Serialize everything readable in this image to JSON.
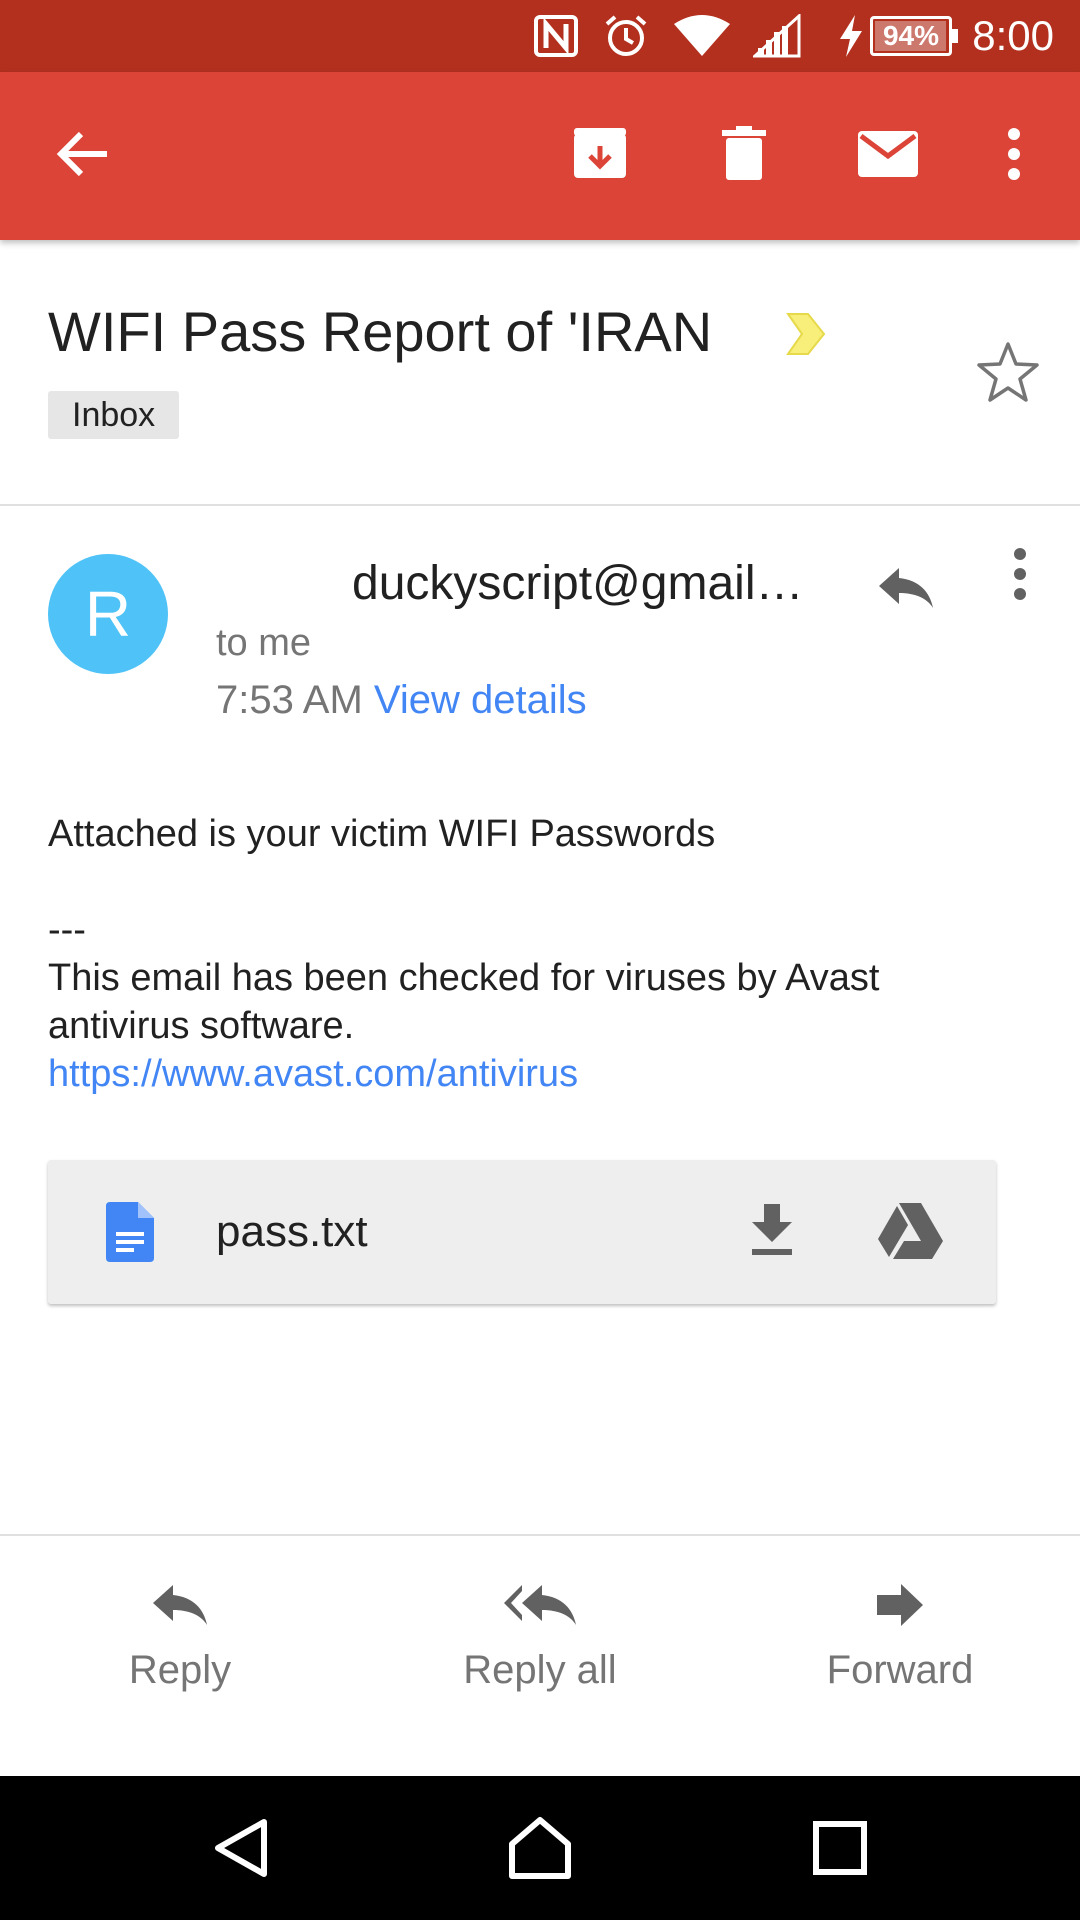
{
  "status_bar": {
    "time": "8:00",
    "battery_percent_label": "94%",
    "battery_level": 0.94,
    "icons": [
      "nfc-icon",
      "alarm-icon",
      "wifi-icon",
      "cell-signal-icon",
      "charging-bolt-icon",
      "battery-icon"
    ]
  },
  "app_bar": {
    "actions": [
      "back-arrow-icon",
      "archive-icon",
      "delete-icon",
      "mark-unread-icon",
      "overflow-menu-icon"
    ],
    "color": "#db4437",
    "status_color": "#b3301f"
  },
  "thread": {
    "subject": "WIFI Pass Report of  ʹIRAN",
    "label": "Inbox",
    "starred": false,
    "importance_marker_color": "#f7ef7a"
  },
  "message": {
    "avatar_letter": "R",
    "avatar_color": "#4fc3f7",
    "sender": "duckyscript@gmail.com",
    "recipient": "to me",
    "time": "7:53 AM",
    "view_details": "View details",
    "body": {
      "line1": "Attached is your victim WIFI Passwords",
      "separator": "---",
      "line2": "This email has been checked for viruses by Avast",
      "line3": "antivirus software.",
      "link": "https://www.avast.com/antivirus"
    },
    "attachment": {
      "name": "pass.txt",
      "icon": "doc-file-icon"
    }
  },
  "actions": {
    "reply": "Reply",
    "reply_all": "Reply all",
    "forward": "Forward"
  },
  "nav_bar": {
    "buttons": [
      "back-triangle-icon",
      "home-icon",
      "recents-icon"
    ]
  }
}
